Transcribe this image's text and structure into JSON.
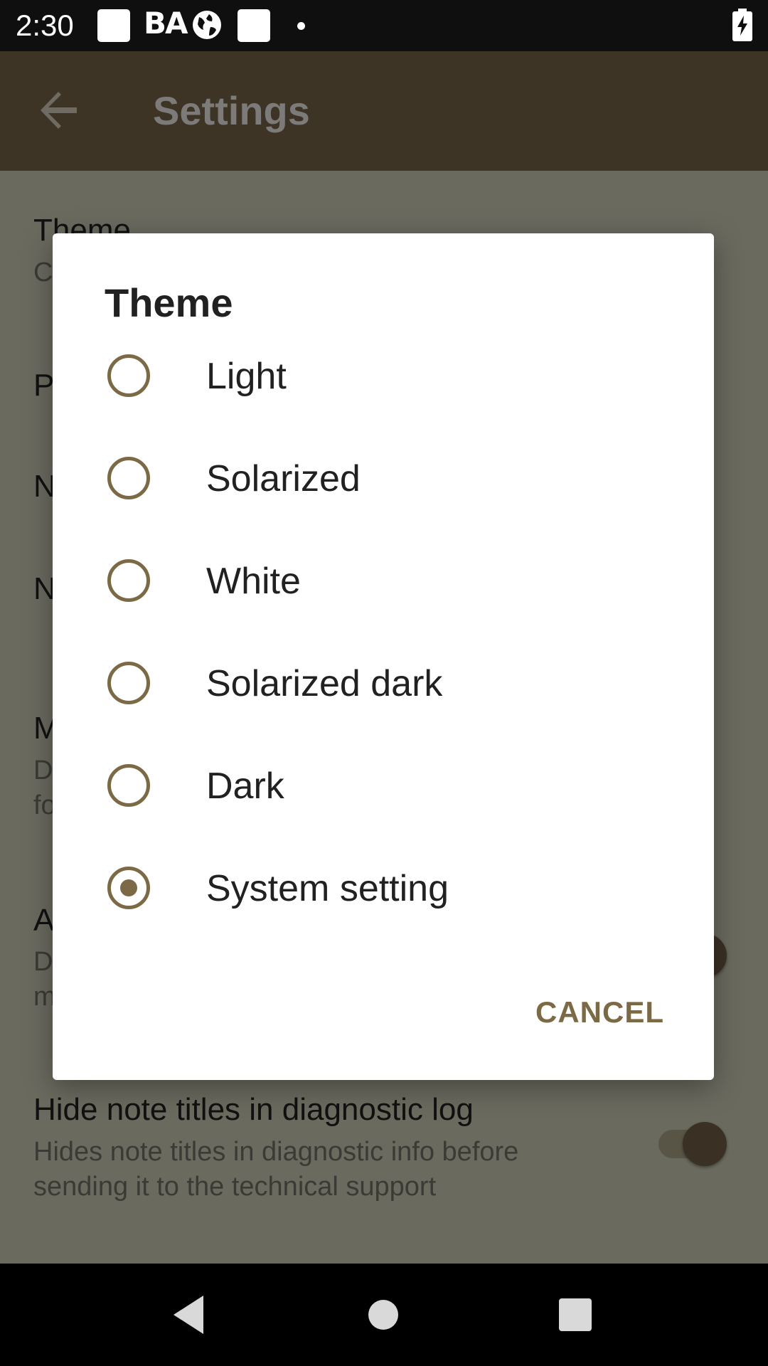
{
  "status_bar": {
    "time": "2:30",
    "carrier_text": "BA",
    "icons": [
      "notification-square-icon",
      "carrier-text-icon",
      "globe-icon",
      "notification-square-icon",
      "dot-icon",
      "battery-charging-icon"
    ]
  },
  "app_bar": {
    "title": "Settings",
    "back_icon": "arrow-back-icon"
  },
  "settings": {
    "theme_title": "Theme",
    "theme_summary": "C",
    "item2_initial": "P",
    "item3_initial": "N",
    "item4_initial": "N",
    "item5_title_initial": "M",
    "item5_summary_line1": "D",
    "item5_summary_line2": "fo",
    "item6_title_initial": "A",
    "item6_summary_line1": "D",
    "item6_summary_line2": "m",
    "hide_titles_title": "Hide note titles in diagnostic log",
    "hide_titles_summary_line1": "Hides note titles in diagnostic info before",
    "hide_titles_summary_line2": "sending it to the technical support"
  },
  "dialog": {
    "title": "Theme",
    "options": [
      {
        "label": "Light",
        "checked": false
      },
      {
        "label": "Solarized",
        "checked": false
      },
      {
        "label": "White",
        "checked": false
      },
      {
        "label": "Solarized dark",
        "checked": false
      },
      {
        "label": "Dark",
        "checked": false
      },
      {
        "label": "System setting",
        "checked": true
      }
    ],
    "cancel_label": "CANCEL"
  },
  "nav_bar": {
    "icons": [
      "nav-back-icon",
      "nav-home-icon",
      "nav-recents-icon"
    ]
  },
  "colors": {
    "accent": "#7b6a45",
    "app_bar": "#3e3426",
    "scrim_content": "#6a6a5f"
  }
}
